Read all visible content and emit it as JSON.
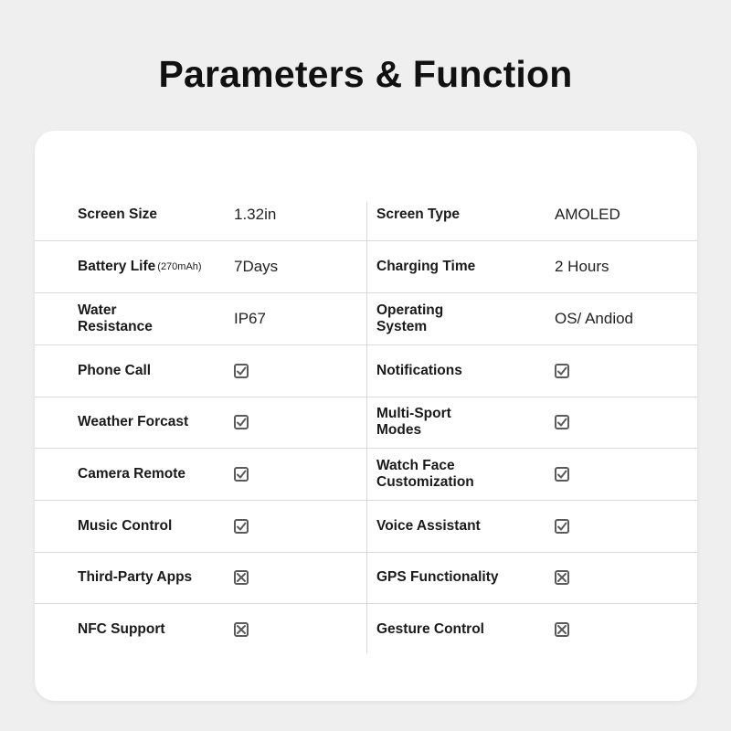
{
  "title": "Parameters & Function",
  "colors": {
    "background": "#efefef",
    "card": "#ffffff",
    "text": "#111111",
    "icon": "#5a5a5a",
    "divider": "#dadada"
  },
  "rows": [
    {
      "left": {
        "label": "Screen Size",
        "sub": "",
        "value": "1.32in",
        "icon": ""
      },
      "right": {
        "label": "Screen Type",
        "sub": "",
        "value": "AMOLED",
        "icon": ""
      }
    },
    {
      "left": {
        "label": "Battery Life",
        "sub": "(270mAh)",
        "value": "7Days",
        "icon": ""
      },
      "right": {
        "label": "Charging Time",
        "sub": "",
        "value": "2 Hours",
        "icon": ""
      }
    },
    {
      "left": {
        "label": "Water Resistance",
        "sub": "",
        "value": "IP67",
        "icon": ""
      },
      "right": {
        "label": "Operating System",
        "sub": "",
        "value": "OS/ Andiod",
        "icon": ""
      }
    },
    {
      "left": {
        "label": "Phone Call",
        "sub": "",
        "value": "",
        "icon": "check-icon"
      },
      "right": {
        "label": "Notifications",
        "sub": "",
        "value": "",
        "icon": "check-icon"
      }
    },
    {
      "left": {
        "label": "Weather Forcast",
        "sub": "",
        "value": "",
        "icon": "check-icon"
      },
      "right": {
        "label": "Multi-Sport Modes",
        "sub": "",
        "value": "",
        "icon": "check-icon"
      }
    },
    {
      "left": {
        "label": "Camera Remote",
        "sub": "",
        "value": "",
        "icon": "check-icon"
      },
      "right": {
        "label": "Watch Face Customization",
        "sub": "",
        "value": "",
        "icon": "check-icon"
      }
    },
    {
      "left": {
        "label": "Music Control",
        "sub": "",
        "value": "",
        "icon": "check-icon"
      },
      "right": {
        "label": "Voice Assistant",
        "sub": "",
        "value": "",
        "icon": "check-icon"
      }
    },
    {
      "left": {
        "label": "Third-Party Apps",
        "sub": "",
        "value": "",
        "icon": "cross-icon"
      },
      "right": {
        "label": "GPS Functionality",
        "sub": "",
        "value": "",
        "icon": "cross-icon"
      }
    },
    {
      "left": {
        "label": "NFC Support",
        "sub": "",
        "value": "",
        "icon": "cross-icon"
      },
      "right": {
        "label": "Gesture Control",
        "sub": "",
        "value": "",
        "icon": "cross-icon"
      }
    }
  ]
}
